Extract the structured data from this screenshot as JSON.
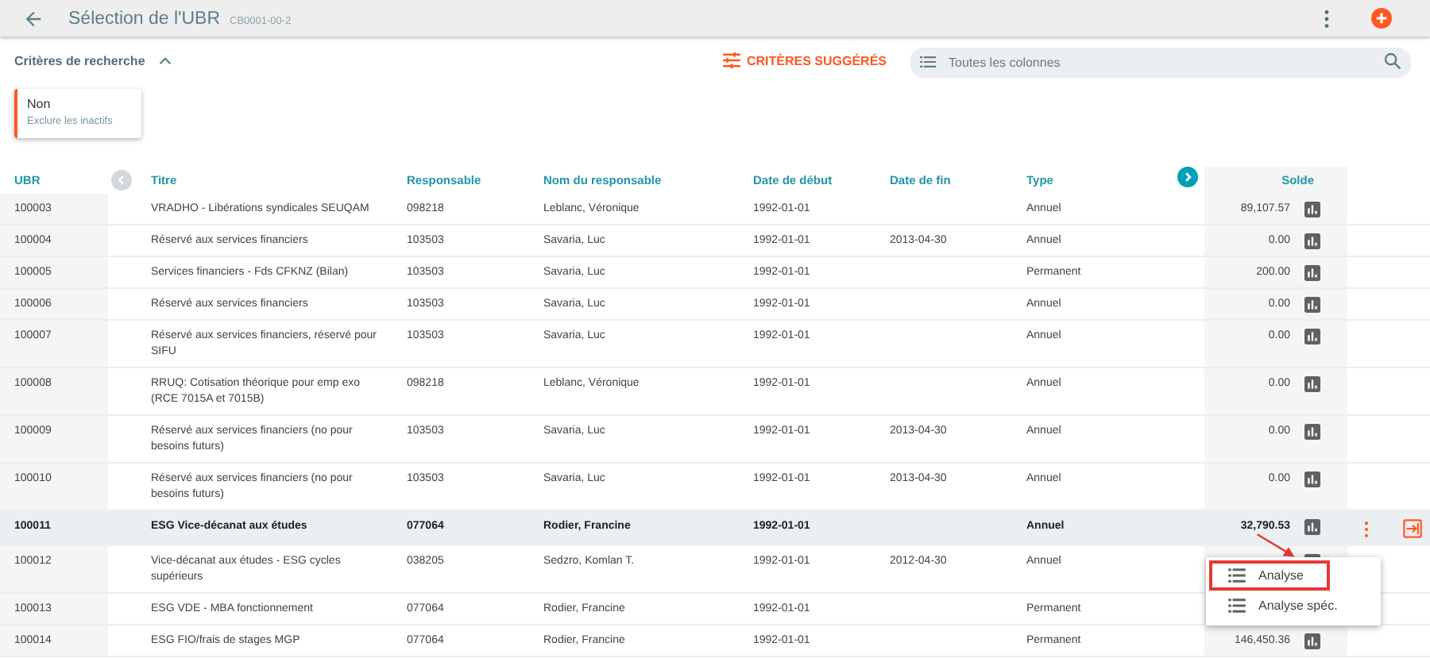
{
  "header": {
    "title": "Sélection de l'UBR",
    "subtitle": "CB0001-00-2"
  },
  "criteria": {
    "label": "Critères de recherche",
    "expanded": true,
    "suggested_label": "CRITÈRES SUGGÉRÉS",
    "search": {
      "placeholder": "Toutes les colonnes"
    },
    "filters": [
      {
        "value": "Non",
        "label": "Exclure les inactifs"
      }
    ]
  },
  "table": {
    "columns": [
      "UBR",
      "Titre",
      "Responsable",
      "Nom du responsable",
      "Date de début",
      "Date de fin",
      "Type",
      "Solde"
    ],
    "rows": [
      {
        "ubr": "100003",
        "title": "VRADHO - Libérations syndicales SEUQAM",
        "resp": "098218",
        "name": "Leblanc, Véronique",
        "start": "1992-01-01",
        "end": "",
        "type": "Annuel",
        "solde": "89,107.57",
        "selected": false
      },
      {
        "ubr": "100004",
        "title": "Réservé aux services financiers",
        "resp": "103503",
        "name": "Savaria, Luc",
        "start": "1992-01-01",
        "end": "2013-04-30",
        "type": "Annuel",
        "solde": "0.00",
        "selected": false
      },
      {
        "ubr": "100005",
        "title": "Services financiers - Fds CFKNZ (Bilan)",
        "resp": "103503",
        "name": "Savaria, Luc",
        "start": "1992-01-01",
        "end": "",
        "type": "Permanent",
        "solde": "200.00",
        "selected": false
      },
      {
        "ubr": "100006",
        "title": "Réservé aux services financiers",
        "resp": "103503",
        "name": "Savaria, Luc",
        "start": "1992-01-01",
        "end": "",
        "type": "Annuel",
        "solde": "0.00",
        "selected": false
      },
      {
        "ubr": "100007",
        "title": "Réservé aux services financiers, réservé pour SIFU",
        "resp": "103503",
        "name": "Savaria, Luc",
        "start": "1992-01-01",
        "end": "",
        "type": "Annuel",
        "solde": "0.00",
        "selected": false
      },
      {
        "ubr": "100008",
        "title": "RRUQ: Cotisation théorique pour emp exo (RCE 7015A et 7015B)",
        "resp": "098218",
        "name": "Leblanc, Véronique",
        "start": "1992-01-01",
        "end": "",
        "type": "Annuel",
        "solde": "0.00",
        "selected": false
      },
      {
        "ubr": "100009",
        "title": "Réservé aux services financiers (no pour besoins futurs)",
        "resp": "103503",
        "name": "Savaria, Luc",
        "start": "1992-01-01",
        "end": "2013-04-30",
        "type": "Annuel",
        "solde": "0.00",
        "selected": false
      },
      {
        "ubr": "100010",
        "title": "Réservé aux services financiers (no pour besoins futurs)",
        "resp": "103503",
        "name": "Savaria, Luc",
        "start": "1992-01-01",
        "end": "2013-04-30",
        "type": "Annuel",
        "solde": "0.00",
        "selected": false
      },
      {
        "ubr": "100011",
        "title": "ESG Vice-décanat aux études",
        "resp": "077064",
        "name": "Rodier, Francine",
        "start": "1992-01-01",
        "end": "",
        "type": "Annuel",
        "solde": "32,790.53",
        "selected": true
      },
      {
        "ubr": "100012",
        "title": "Vice-décanat aux études - ESG cycles supérieurs",
        "resp": "038205",
        "name": "Sedzro, Komlan T.",
        "start": "1992-01-01",
        "end": "2012-04-30",
        "type": "Annuel",
        "selected": false
      },
      {
        "ubr": "100013",
        "title": "ESG VDE - MBA fonctionnement",
        "resp": "077064",
        "name": "Rodier, Francine",
        "start": "1992-01-01",
        "end": "",
        "type": "Permanent",
        "selected": false
      },
      {
        "ubr": "100014",
        "title": "ESG FIO/frais de stages MGP",
        "resp": "077064",
        "name": "Rodier, Francine",
        "start": "1992-01-01",
        "end": "",
        "type": "Permanent",
        "solde": "146,450.36",
        "selected": false
      }
    ]
  },
  "context_menu": {
    "items": [
      {
        "label": "Analyse",
        "selected": true
      },
      {
        "label": "Analyse spéc.",
        "selected": false
      }
    ]
  }
}
